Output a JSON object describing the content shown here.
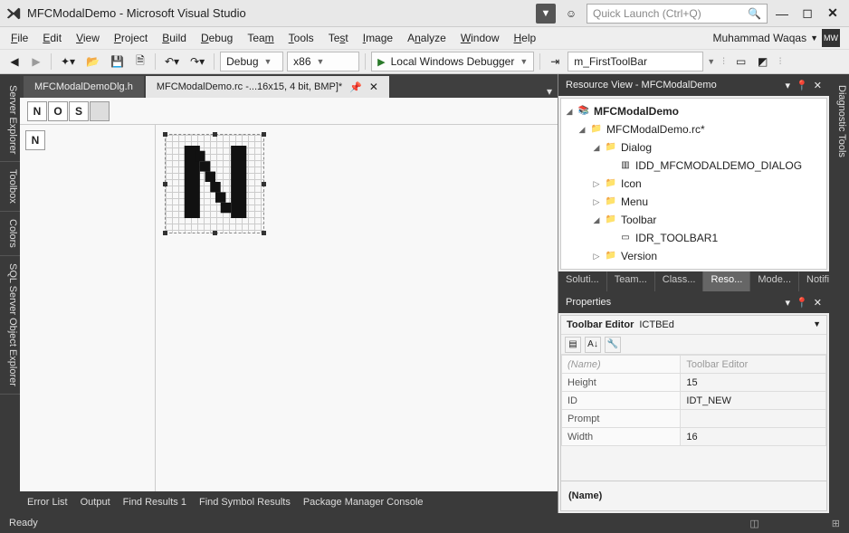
{
  "title": "MFCModalDemo - Microsoft Visual Studio",
  "quicklaunch_placeholder": "Quick Launch (Ctrl+Q)",
  "user_name": "Muhammad Waqas",
  "user_initials": "MW",
  "menus": [
    "File",
    "Edit",
    "View",
    "Project",
    "Build",
    "Debug",
    "Team",
    "Tools",
    "Test",
    "Image",
    "Analyze",
    "Window",
    "Help"
  ],
  "toolbar": {
    "config": "Debug",
    "platform": "x86",
    "debugger": "Local Windows Debugger",
    "object_combo": "m_FirstToolBar"
  },
  "left_tabs": [
    "Server Explorer",
    "Toolbox",
    "Colors",
    "SQL Server Object Explorer"
  ],
  "right_tabs": [
    "Diagnostic Tools"
  ],
  "doc_tabs": {
    "inactive": "MFCModalDemoDlg.h",
    "active": "MFCModalDemo.rc -...16x15, 4 bit, BMP]*"
  },
  "toolbar_buttons": [
    "N",
    "O",
    "S"
  ],
  "editor_selected": "N",
  "resource_view": {
    "title": "Resource View - MFCModalDemo",
    "root": "MFCModalDemo",
    "rc": "MFCModalDemo.rc*",
    "dialog": "Dialog",
    "dialog_item": "IDD_MFCMODALDEMO_DIALOG",
    "icon": "Icon",
    "menu": "Menu",
    "toolbar": "Toolbar",
    "toolbar_item": "IDR_TOOLBAR1",
    "version": "Version"
  },
  "panel_tabs": [
    "Soluti...",
    "Team...",
    "Class...",
    "Reso...",
    "Mode...",
    "Notifi..."
  ],
  "panel_tabs_active_index": 3,
  "properties": {
    "title": "Properties",
    "object": "Toolbar Editor",
    "object_type": "ICTBEd",
    "rows": [
      {
        "k": "(Name)",
        "v": "Toolbar Editor",
        "name": true
      },
      {
        "k": "Height",
        "v": "15"
      },
      {
        "k": "ID",
        "v": "IDT_NEW"
      },
      {
        "k": "Prompt",
        "v": ""
      },
      {
        "k": "Width",
        "v": "16"
      }
    ],
    "desc": "(Name)"
  },
  "bottom_tabs": [
    "Error List",
    "Output",
    "Find Results 1",
    "Find Symbol Results",
    "Package Manager Console"
  ],
  "status": "Ready"
}
